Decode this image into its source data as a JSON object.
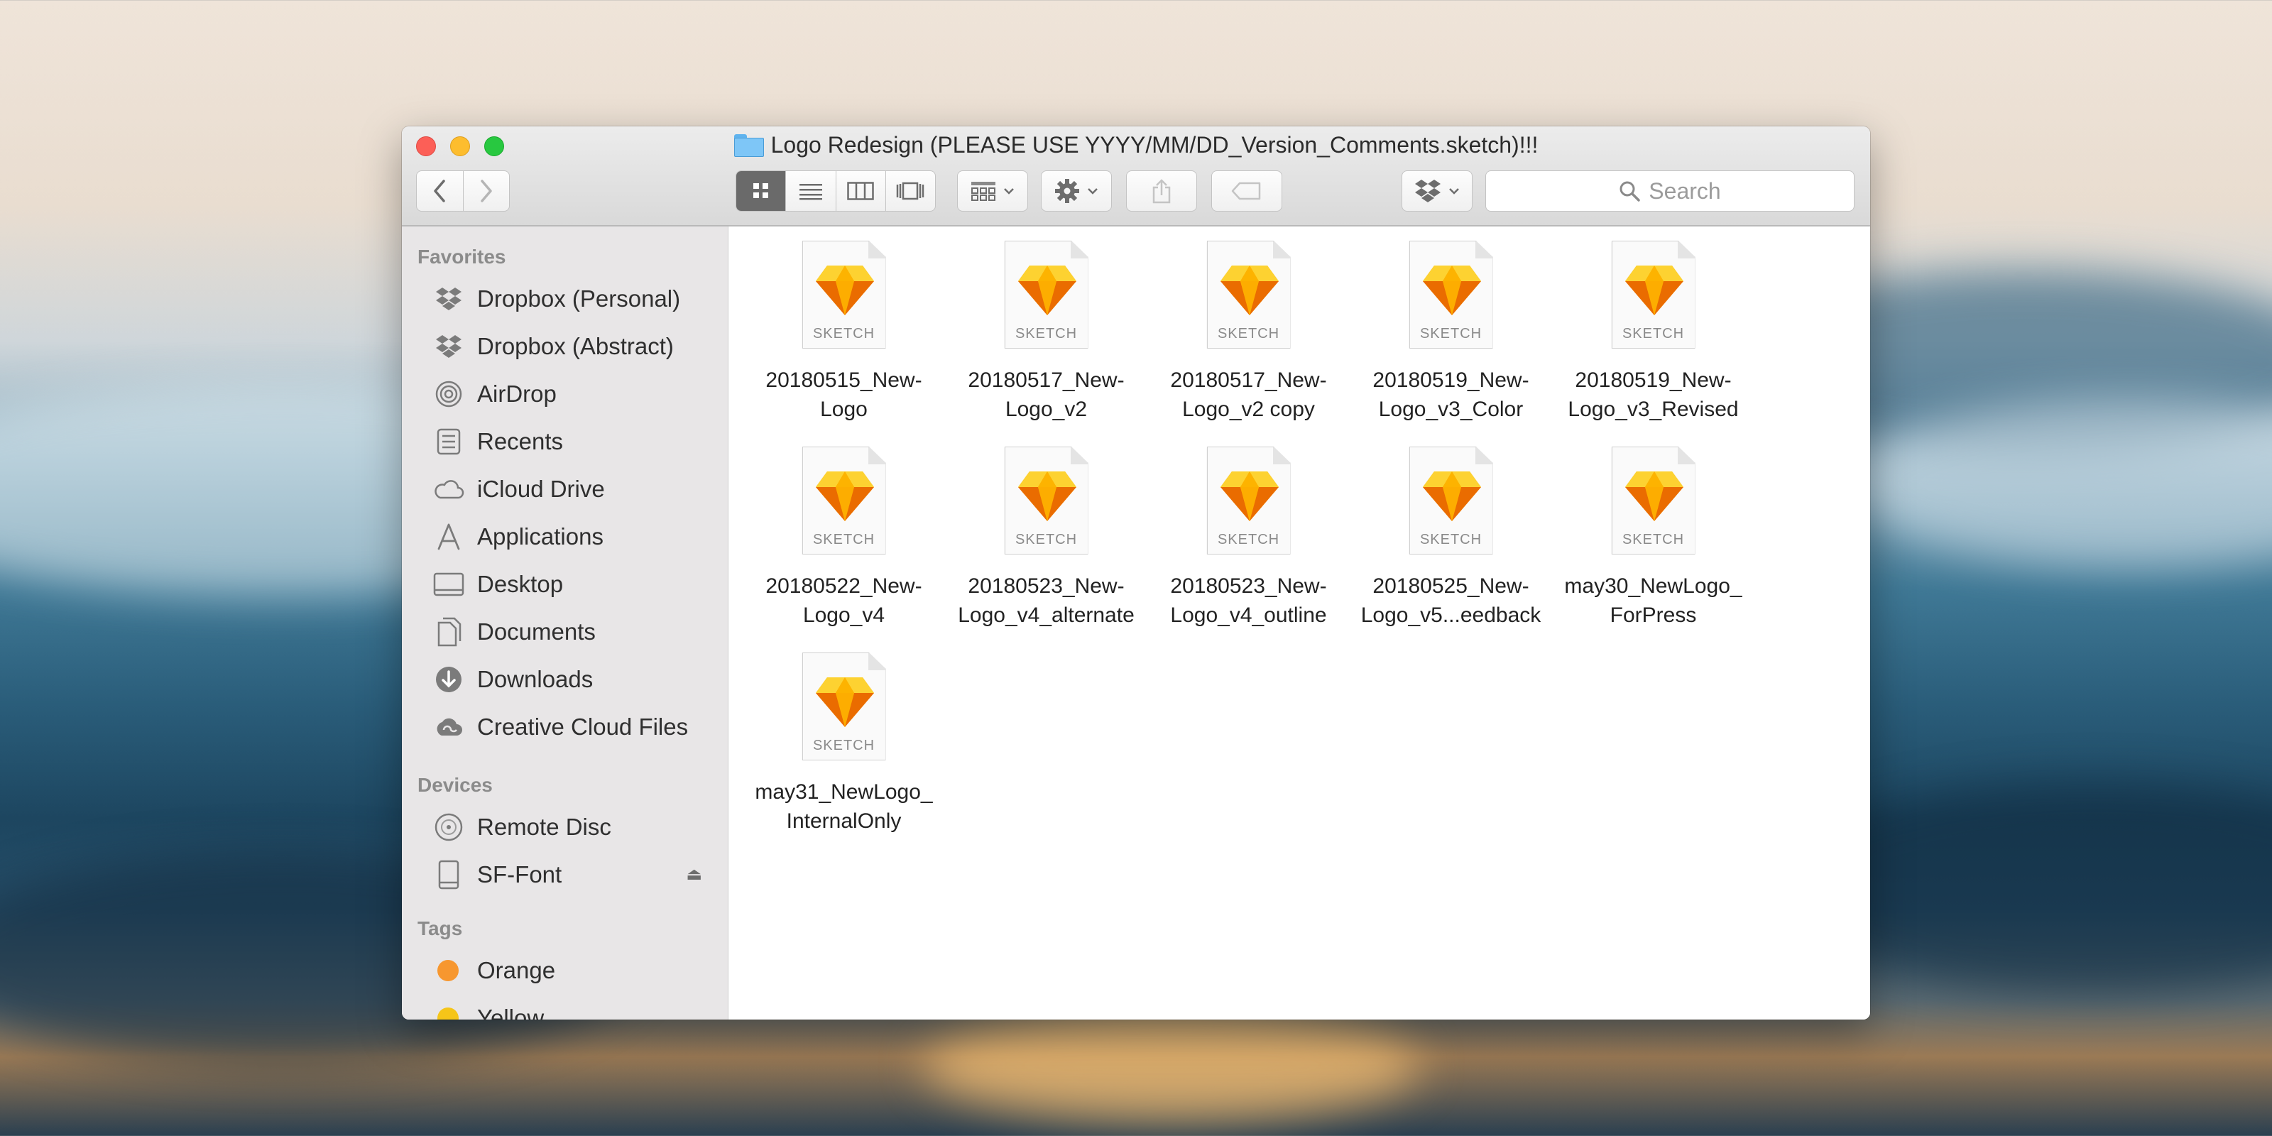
{
  "window": {
    "title": "Logo Redesign (PLEASE USE YYYY/MM/DD_Version_Comments.sketch)!!!"
  },
  "toolbar": {
    "search_placeholder": "Search",
    "back_icon": "chevron-left-icon",
    "forward_icon": "chevron-right-icon"
  },
  "sidebar": {
    "sections": {
      "favorites": "Favorites",
      "devices": "Devices",
      "tags": "Tags"
    },
    "favorites": [
      {
        "label": "Dropbox (Personal)",
        "icon": "dropbox-icon"
      },
      {
        "label": "Dropbox (Abstract)",
        "icon": "dropbox-icon"
      },
      {
        "label": "AirDrop",
        "icon": "airdrop-icon"
      },
      {
        "label": "Recents",
        "icon": "recents-icon"
      },
      {
        "label": "iCloud Drive",
        "icon": "cloud-icon"
      },
      {
        "label": "Applications",
        "icon": "applications-icon"
      },
      {
        "label": "Desktop",
        "icon": "desktop-icon"
      },
      {
        "label": "Documents",
        "icon": "documents-icon"
      },
      {
        "label": "Downloads",
        "icon": "downloads-icon"
      },
      {
        "label": "Creative Cloud Files",
        "icon": "creative-cloud-icon"
      }
    ],
    "devices": [
      {
        "label": "Remote Disc",
        "icon": "disc-icon"
      },
      {
        "label": "SF-Font",
        "icon": "drive-icon"
      }
    ],
    "tags": [
      {
        "label": "Orange",
        "color": "#f7972f"
      },
      {
        "label": "Yellow",
        "color": "#f5c518"
      }
    ]
  },
  "files": {
    "type_label": "SKETCH",
    "items": [
      {
        "line1": "20180515_New-",
        "line2": "Logo"
      },
      {
        "line1": "20180517_New-",
        "line2": "Logo_v2"
      },
      {
        "line1": "20180517_New-",
        "line2": "Logo_v2 copy"
      },
      {
        "line1": "20180519_New-",
        "line2": "Logo_v3_Color"
      },
      {
        "line1": "20180519_New-",
        "line2": "Logo_v3_Revised"
      },
      {
        "line1": "20180522_New-",
        "line2": "Logo_v4"
      },
      {
        "line1": "20180523_New-",
        "line2": "Logo_v4_alternate"
      },
      {
        "line1": "20180523_New-",
        "line2": "Logo_v4_outline"
      },
      {
        "line1": "20180525_New-",
        "line2": "Logo_v5...eedback"
      },
      {
        "line1": "may30_NewLogo_",
        "line2": "ForPress"
      },
      {
        "line1": "may31_NewLogo_",
        "line2": "InternalOnly"
      }
    ]
  }
}
